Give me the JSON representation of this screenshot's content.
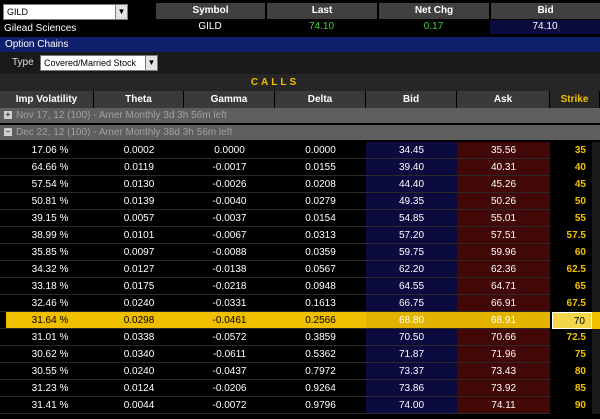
{
  "quote": {
    "symbol_input": "GILD",
    "company": "Gilead Sciences",
    "headers": {
      "symbol": "Symbol",
      "last": "Last",
      "net_chg": "Net Chg",
      "bid": "Bid"
    },
    "values": {
      "symbol": "GILD",
      "last": "74.10",
      "net_chg": "0.17",
      "bid": "74.10"
    }
  },
  "option_chains": {
    "title": "Option Chains",
    "type_label": "Type",
    "type_value": "Covered/Married Stock"
  },
  "calls": {
    "title": "CALLS",
    "columns": [
      "Imp Volatility",
      "Theta",
      "Gamma",
      "Delta",
      "Bid",
      "Ask",
      "Strike"
    ],
    "groups": [
      {
        "expand": "+",
        "label": "Nov 17, 12 (100) - Amer Monthly 3d 3h 56m left"
      },
      {
        "expand": "−",
        "label": "Dec 22, 12 (100) - Amer Monthly 38d 3h 56m left"
      }
    ],
    "rows": [
      {
        "iv": "17.06 %",
        "theta": "0.0002",
        "gamma": "0.0000",
        "delta": "0.0000",
        "bid": "34.45",
        "ask": "35.56",
        "strike": "35"
      },
      {
        "iv": "64.66 %",
        "theta": "0.0119",
        "gamma": "-0.0017",
        "delta": "0.0155",
        "bid": "39.40",
        "ask": "40.31",
        "strike": "40"
      },
      {
        "iv": "57.54 %",
        "theta": "0.0130",
        "gamma": "-0.0026",
        "delta": "0.0208",
        "bid": "44.40",
        "ask": "45.26",
        "strike": "45"
      },
      {
        "iv": "50.81 %",
        "theta": "0.0139",
        "gamma": "-0.0040",
        "delta": "0.0279",
        "bid": "49.35",
        "ask": "50.26",
        "strike": "50"
      },
      {
        "iv": "39.15 %",
        "theta": "0.0057",
        "gamma": "-0.0037",
        "delta": "0.0154",
        "bid": "54.85",
        "ask": "55.01",
        "strike": "55"
      },
      {
        "iv": "38.99 %",
        "theta": "0.0101",
        "gamma": "-0.0067",
        "delta": "0.0313",
        "bid": "57.20",
        "ask": "57.51",
        "strike": "57.5"
      },
      {
        "iv": "35.85 %",
        "theta": "0.0097",
        "gamma": "-0.0088",
        "delta": "0.0359",
        "bid": "59.75",
        "ask": "59.96",
        "strike": "60"
      },
      {
        "iv": "34.32 %",
        "theta": "0.0127",
        "gamma": "-0.0138",
        "delta": "0.0567",
        "bid": "62.20",
        "ask": "62.36",
        "strike": "62.5"
      },
      {
        "iv": "33.18 %",
        "theta": "0.0175",
        "gamma": "-0.0218",
        "delta": "0.0948",
        "bid": "64.55",
        "ask": "64.71",
        "strike": "65"
      },
      {
        "iv": "32.46 %",
        "theta": "0.0240",
        "gamma": "-0.0331",
        "delta": "0.1613",
        "bid": "66.75",
        "ask": "66.91",
        "strike": "67.5"
      },
      {
        "iv": "31.64 %",
        "theta": "0.0298",
        "gamma": "-0.0461",
        "delta": "0.2566",
        "bid": "68.80",
        "ask": "68.91",
        "strike": "70",
        "highlight": true
      },
      {
        "iv": "31.01 %",
        "theta": "0.0338",
        "gamma": "-0.0572",
        "delta": "0.3859",
        "bid": "70.50",
        "ask": "70.66",
        "strike": "72.5"
      },
      {
        "iv": "30.62 %",
        "theta": "0.0340",
        "gamma": "-0.0611",
        "delta": "0.5362",
        "bid": "71.87",
        "ask": "71.96",
        "strike": "75"
      },
      {
        "iv": "30.55 %",
        "theta": "0.0240",
        "gamma": "-0.0437",
        "delta": "0.7972",
        "bid": "73.37",
        "ask": "73.43",
        "strike": "80"
      },
      {
        "iv": "31.23 %",
        "theta": "0.0124",
        "gamma": "-0.0206",
        "delta": "0.9264",
        "bid": "73.86",
        "ask": "73.92",
        "strike": "85"
      },
      {
        "iv": "31.41 %",
        "theta": "0.0044",
        "gamma": "-0.0072",
        "delta": "0.9796",
        "bid": "74.00",
        "ask": "74.11",
        "strike": "90"
      }
    ]
  },
  "colors": {
    "accent_yellow": "#f0c000",
    "positive_green": "#3ad13a",
    "bid_bg": "#0b0b3f",
    "ask_bg": "#420808",
    "header_blue": "#0f1f6b"
  },
  "icons": {
    "dropdown": "chevron-down-icon",
    "expand": "plus-square-icon",
    "collapse": "minus-square-icon"
  }
}
